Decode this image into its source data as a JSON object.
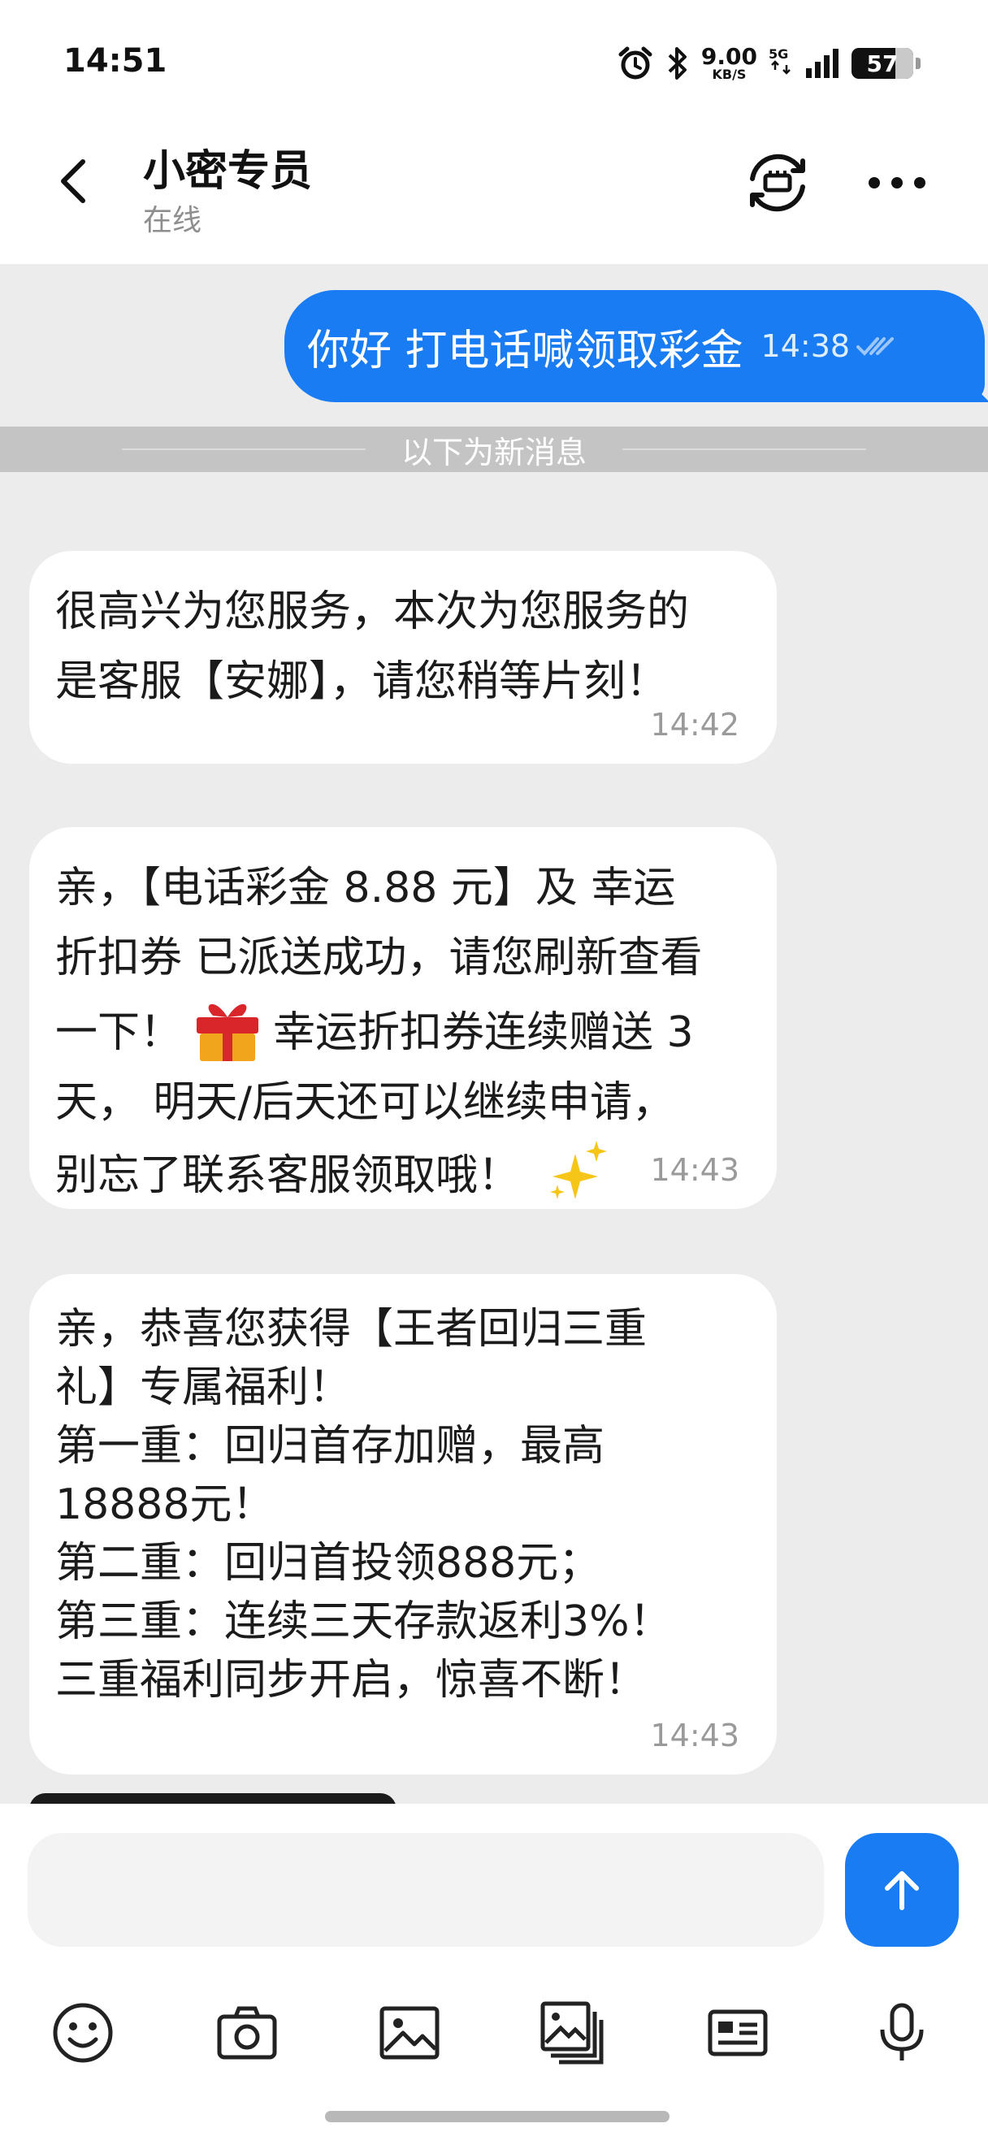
{
  "status_bar": {
    "time": "14:51",
    "net_speed_value": "9.00",
    "net_speed_unit": "KB/S",
    "battery": "57",
    "icons": [
      "alarm-icon",
      "bluetooth-icon",
      "5g-icon",
      "signal-icon",
      "battery-icon"
    ]
  },
  "header": {
    "contact_name": "小密专员",
    "contact_status": "在线",
    "icons": [
      "back-icon",
      "switch-icon",
      "more-icon"
    ]
  },
  "messages": {
    "outgoing": {
      "text": "你好 打电话喊领取彩金",
      "time": "14:38",
      "read_icon": "double-check-icon"
    },
    "divider": "以下为新消息",
    "incoming": [
      {
        "text": "很高兴为您服务，本次为您服务的\n是客服【安娜】，请您稍等片刻！",
        "time": "14:42"
      },
      {
        "text_a": "亲，【电话彩金 8.88 元】及 幸运\n折扣券 已派送成功，请您刷新查看\n一下！",
        "emoji_gift": "gift-emoji",
        "text_b": "幸运折扣券连续赠送 3\n天， 明天/后天还可以继续申请，\n别忘了联系客服领取哦！",
        "emoji_spark": "sparkles-emoji",
        "time": "14:43"
      },
      {
        "text": "亲，恭喜您获得【王者回归三重\n礼】专属福利！\n第一重：回归首存加赠，最高\n18888元！\n第二重：回归首投领888元；\n第三重：连续三天存款返利3%！\n三重福利同步开启，惊喜不断！",
        "time": "14:43"
      }
    ]
  },
  "input": {
    "value": "",
    "placeholder": ""
  },
  "toolbar": {
    "icons": [
      "emoji-icon",
      "camera-icon",
      "image-icon",
      "gallery-icon",
      "card-icon",
      "microphone-icon"
    ]
  },
  "colors": {
    "accent": "#1a7cf2",
    "background": "#ececec",
    "bubble_in": "#ffffff"
  }
}
